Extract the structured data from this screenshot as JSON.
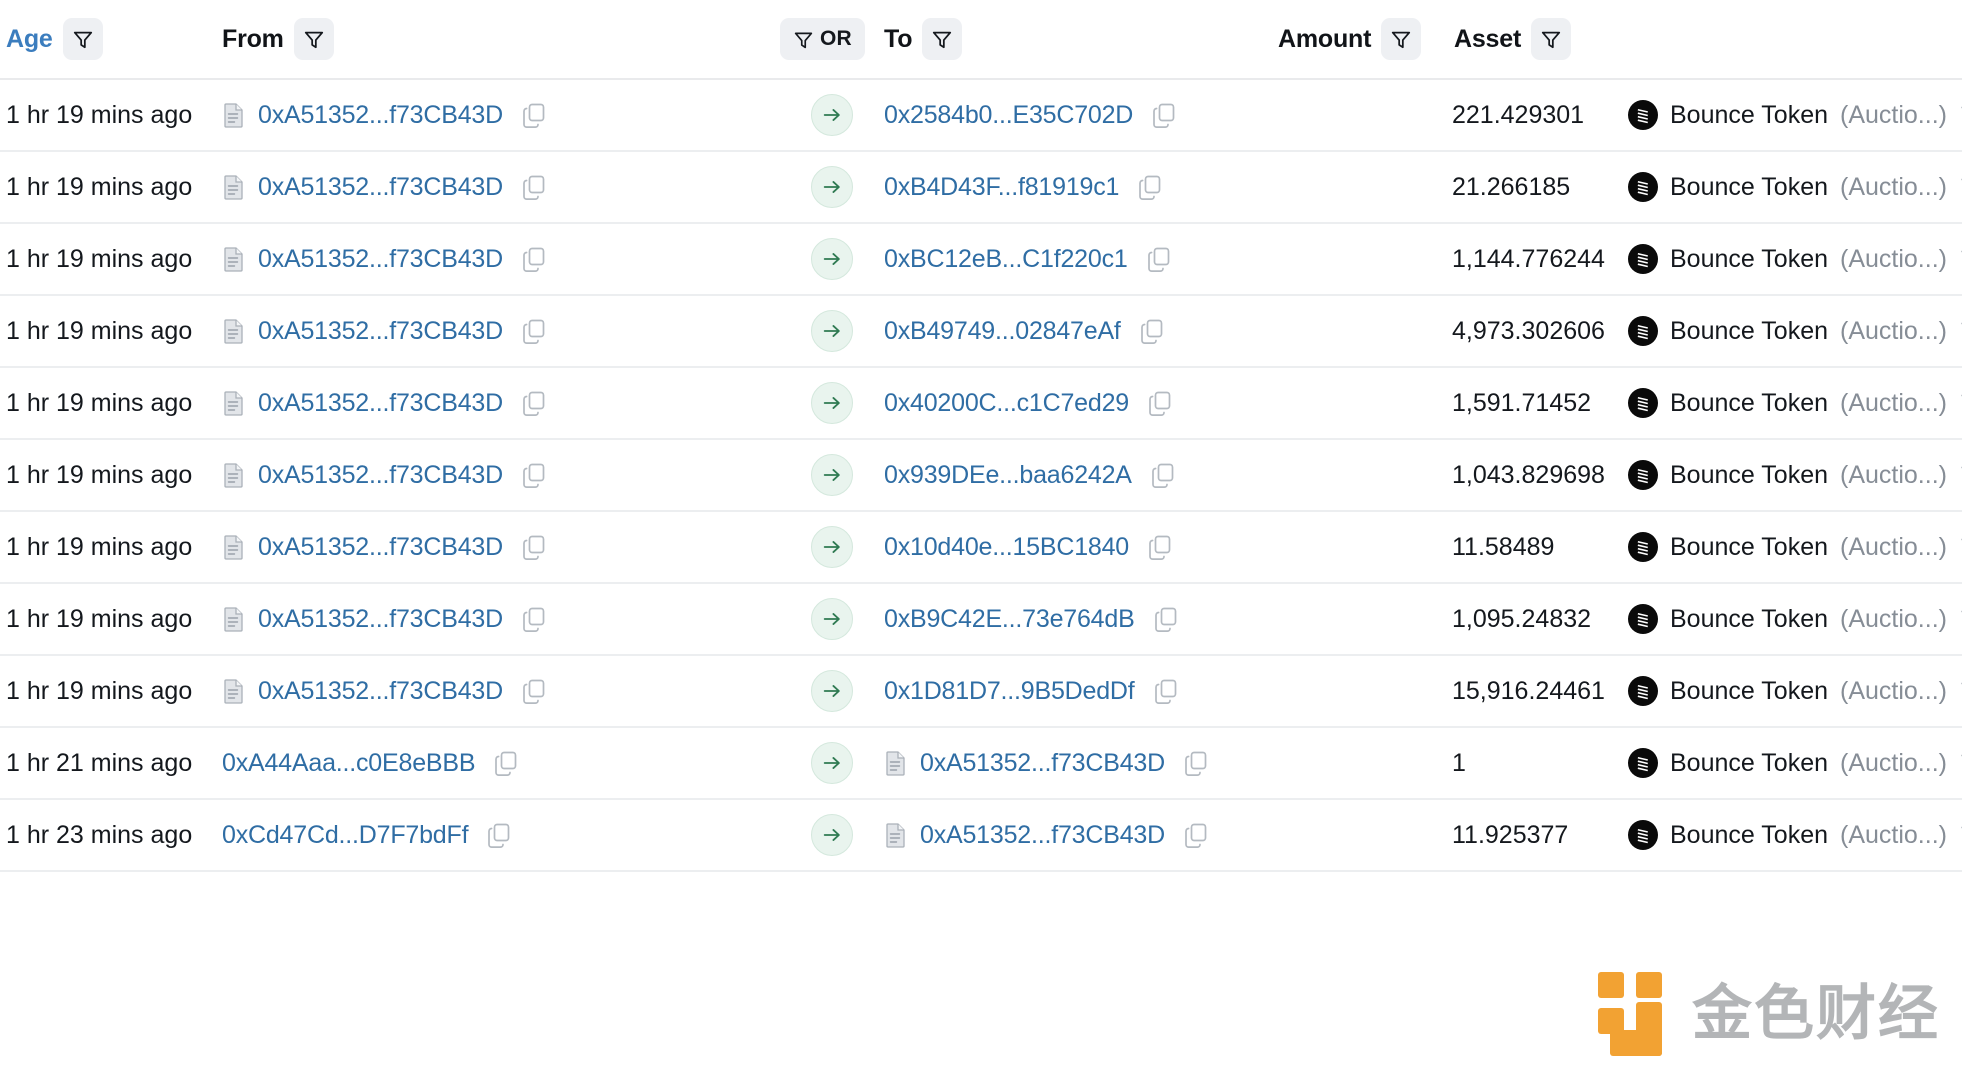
{
  "header": {
    "columns": [
      {
        "label": "Age",
        "icon": "filter-funnel-icon",
        "link": true
      },
      {
        "label": "From",
        "icon": "filter-funnel-icon",
        "link": false
      },
      {
        "label": "To",
        "icon": "filter-funnel-icon",
        "link": false
      },
      {
        "label": "Amount",
        "icon": "filter-funnel-icon",
        "link": false
      },
      {
        "label": "Asset",
        "icon": "filter-funnel-icon",
        "link": false
      }
    ],
    "or_chip": {
      "label": "OR",
      "icon": "filter-funnel-icon"
    }
  },
  "icons": {
    "document": "document-icon",
    "copy": "copy-icon",
    "arrow": "arrow-right-icon",
    "token": "bounce-token-icon",
    "funnel": "filter-funnel-icon",
    "watermark": "jinse-finance-logo"
  },
  "colors": {
    "link": "#2f6da4",
    "header_link": "#3b7dbe",
    "text": "#14181d",
    "muted": "#868d96",
    "chip_bg": "#eef0f3",
    "arrow_bg": "#e9f4ee",
    "arrow_fg": "#2f7a52",
    "token_bg": "#0a0a0a",
    "row_border": "#eceef0",
    "watermark_orange": "#f2a233"
  },
  "watermark": {
    "text": "金色财经"
  },
  "rows": [
    {
      "age": "1 hr 19 mins ago",
      "from": "0xA51352...f73CB43D",
      "from_doc": true,
      "to": "0x2584b0...E35C702D",
      "to_doc": false,
      "amount": "221.429301",
      "asset": "Bounce Token",
      "asset_sub": "(Auctio...)"
    },
    {
      "age": "1 hr 19 mins ago",
      "from": "0xA51352...f73CB43D",
      "from_doc": true,
      "to": "0xB4D43F...f81919c1",
      "to_doc": false,
      "amount": "21.266185",
      "asset": "Bounce Token",
      "asset_sub": "(Auctio...)"
    },
    {
      "age": "1 hr 19 mins ago",
      "from": "0xA51352...f73CB43D",
      "from_doc": true,
      "to": "0xBC12eB...C1f220c1",
      "to_doc": false,
      "amount": "1,144.776244",
      "asset": "Bounce Token",
      "asset_sub": "(Auctio...)"
    },
    {
      "age": "1 hr 19 mins ago",
      "from": "0xA51352...f73CB43D",
      "from_doc": true,
      "to": "0xB49749...02847eAf",
      "to_doc": false,
      "amount": "4,973.302606",
      "asset": "Bounce Token",
      "asset_sub": "(Auctio...)"
    },
    {
      "age": "1 hr 19 mins ago",
      "from": "0xA51352...f73CB43D",
      "from_doc": true,
      "to": "0x40200C...c1C7ed29",
      "to_doc": false,
      "amount": "1,591.71452",
      "asset": "Bounce Token",
      "asset_sub": "(Auctio...)"
    },
    {
      "age": "1 hr 19 mins ago",
      "from": "0xA51352...f73CB43D",
      "from_doc": true,
      "to": "0x939DEe...baa6242A",
      "to_doc": false,
      "amount": "1,043.829698",
      "asset": "Bounce Token",
      "asset_sub": "(Auctio...)"
    },
    {
      "age": "1 hr 19 mins ago",
      "from": "0xA51352...f73CB43D",
      "from_doc": true,
      "to": "0x10d40e...15BC1840",
      "to_doc": false,
      "amount": "11.58489",
      "asset": "Bounce Token",
      "asset_sub": "(Auctio...)"
    },
    {
      "age": "1 hr 19 mins ago",
      "from": "0xA51352...f73CB43D",
      "from_doc": true,
      "to": "0xB9C42E...73e764dB",
      "to_doc": false,
      "amount": "1,095.24832",
      "asset": "Bounce Token",
      "asset_sub": "(Auctio...)"
    },
    {
      "age": "1 hr 19 mins ago",
      "from": "0xA51352...f73CB43D",
      "from_doc": true,
      "to": "0x1D81D7...9B5DedDf",
      "to_doc": false,
      "amount": "15,916.24461",
      "asset": "Bounce Token",
      "asset_sub": "(Auctio...)"
    },
    {
      "age": "1 hr 21 mins ago",
      "from": "0xA44Aaa...c0E8eBBB",
      "from_doc": false,
      "to": "0xA51352...f73CB43D",
      "to_doc": true,
      "amount": "1",
      "asset": "Bounce Token",
      "asset_sub": "(Auctio...)"
    },
    {
      "age": "1 hr 23 mins ago",
      "from": "0xCd47Cd...D7F7bdFf",
      "from_doc": false,
      "to": "0xA51352...f73CB43D",
      "to_doc": true,
      "amount": "11.925377",
      "asset": "Bounce Token",
      "asset_sub": "(Auctio...)"
    }
  ]
}
